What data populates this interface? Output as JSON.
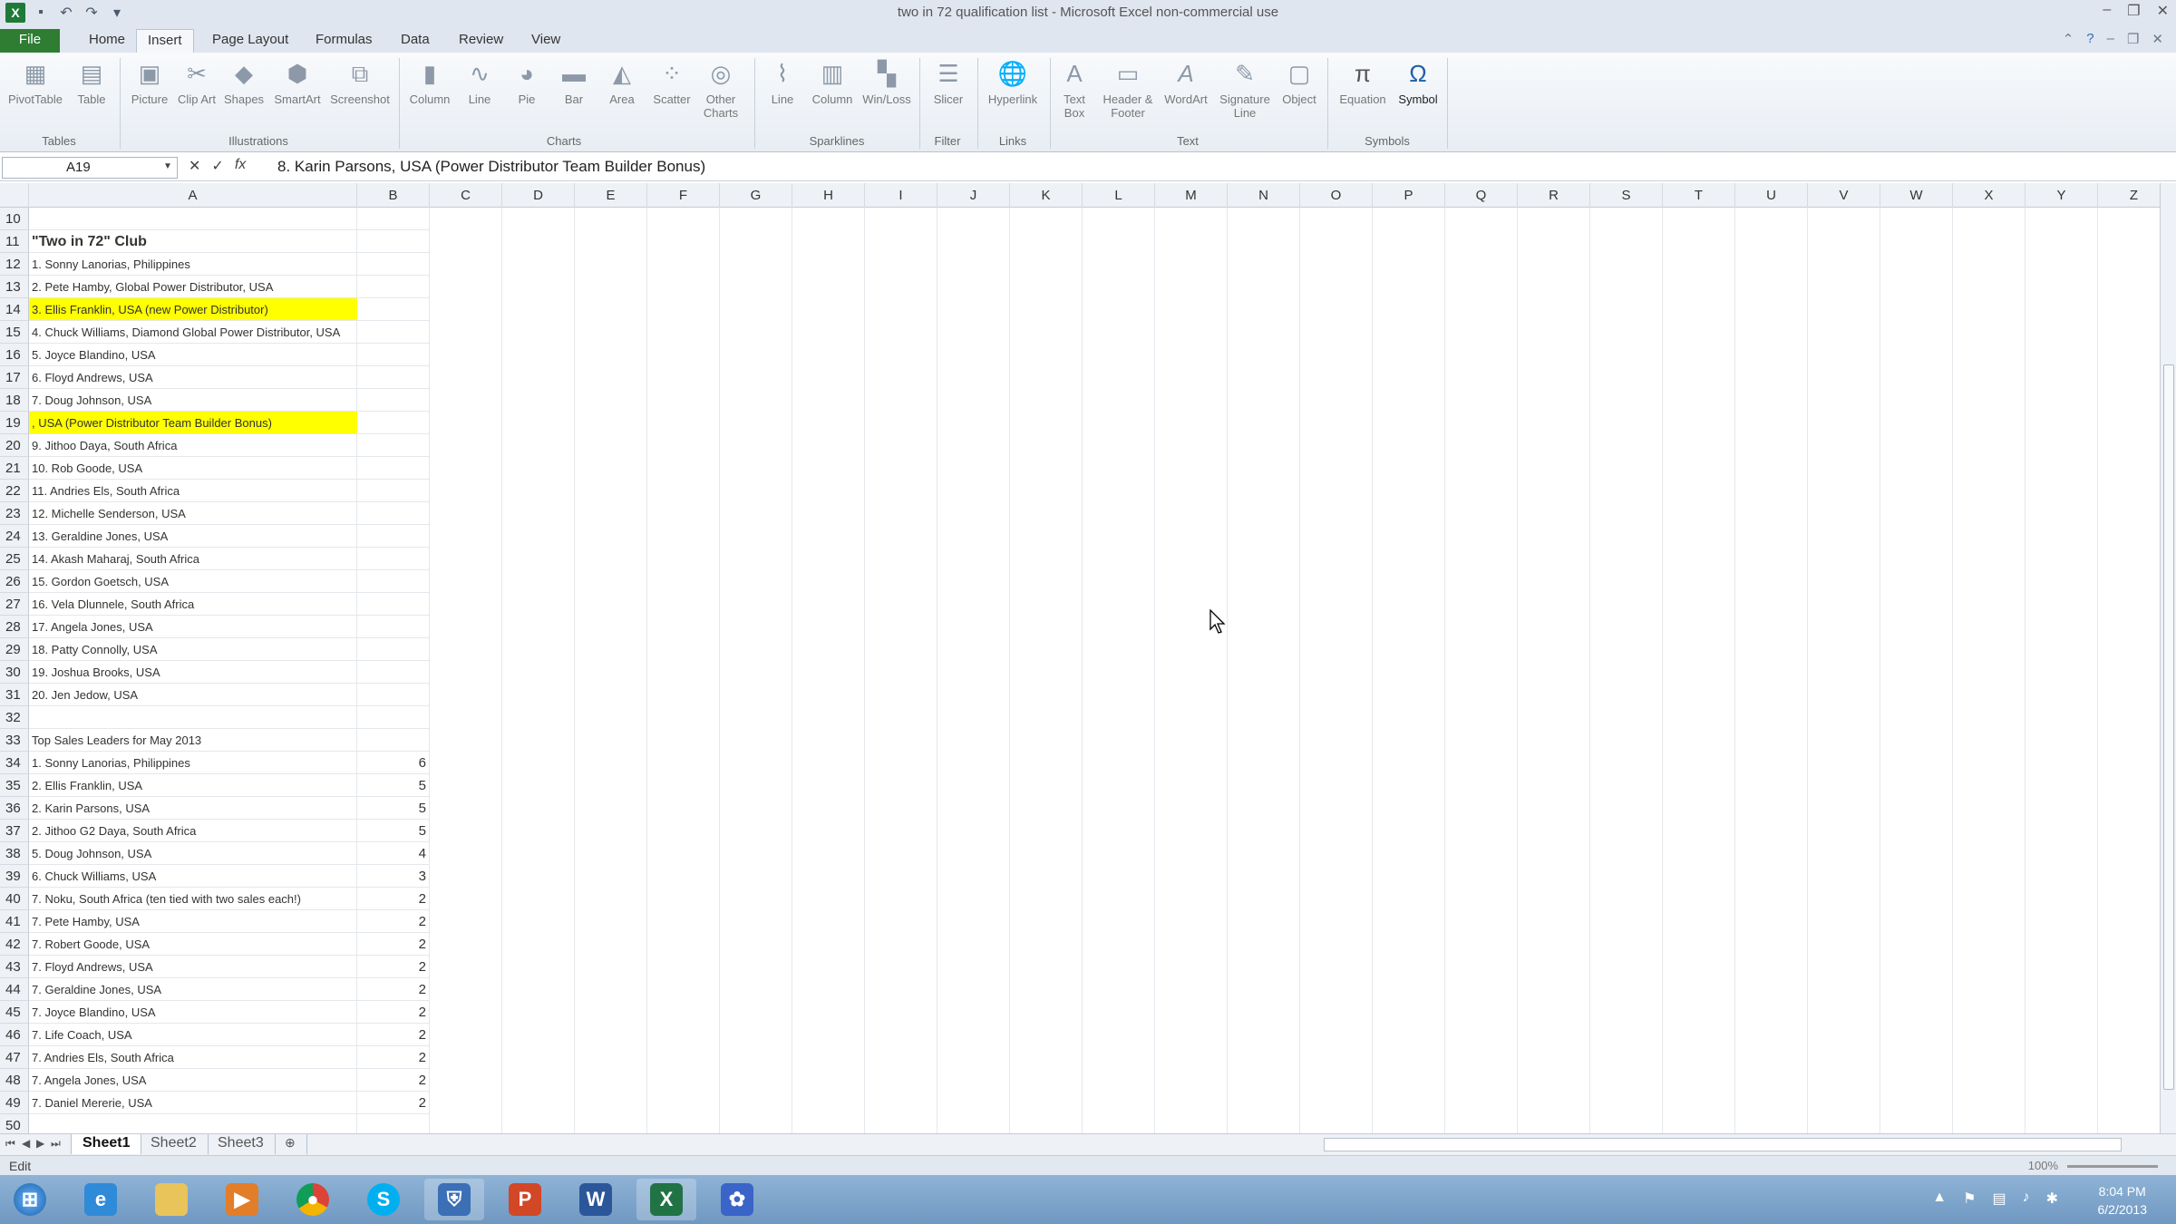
{
  "window": {
    "title": "two in 72 qualification list  -  Microsoft Excel non-commercial use",
    "controls": [
      "–",
      "❐",
      "✕"
    ]
  },
  "ribbon_tabs": [
    "File",
    "Home",
    "Insert",
    "Page Layout",
    "Formulas",
    "Data",
    "Review",
    "View"
  ],
  "ribbon": {
    "groups": [
      {
        "label": "Tables",
        "buttons": [
          "PivotTable",
          "Table"
        ]
      },
      {
        "label": "Illustrations",
        "buttons": [
          "Picture",
          "Clip Art",
          "Shapes",
          "SmartArt",
          "Screenshot"
        ]
      },
      {
        "label": "Charts",
        "buttons": [
          "Column",
          "Line",
          "Pie",
          "Bar",
          "Area",
          "Scatter",
          "Other Charts"
        ]
      },
      {
        "label": "Sparklines",
        "buttons": [
          "Line",
          "Column",
          "Win/Loss"
        ]
      },
      {
        "label": "Filter",
        "buttons": [
          "Slicer"
        ]
      },
      {
        "label": "Links",
        "buttons": [
          "Hyperlink"
        ]
      },
      {
        "label": "Text",
        "buttons": [
          "Text Box",
          "Header & Footer",
          "WordArt",
          "Signature Line",
          "Object"
        ]
      },
      {
        "label": "Symbols",
        "buttons": [
          "Equation",
          "Symbol"
        ]
      }
    ]
  },
  "formula_bar": {
    "name_box": "A19",
    "formula": "8. Karin Parsons, USA (Power Distributor Team Builder Bonus)"
  },
  "columns": [
    "A",
    "B",
    "C",
    "D",
    "E",
    "F",
    "G",
    "H",
    "I",
    "J",
    "K",
    "L",
    "M",
    "N",
    "O",
    "P",
    "Q",
    "R",
    "S",
    "T",
    "U",
    "V",
    "W",
    "X",
    "Y",
    "Z"
  ],
  "rows": [
    {
      "n": "10",
      "a": "",
      "b": ""
    },
    {
      "n": "11",
      "a": "\"Two in 72\" Club",
      "b": "",
      "bold": true
    },
    {
      "n": "12",
      "a": "1. Sonny Lanorias, Philippines",
      "b": ""
    },
    {
      "n": "13",
      "a": "2. Pete Hamby, Global Power Distributor, USA",
      "b": ""
    },
    {
      "n": "14",
      "a": "3. Ellis Franklin, USA (new Power Distributor)",
      "b": "",
      "highlight": true
    },
    {
      "n": "15",
      "a": "4. Chuck Williams, Diamond Global Power Distributor, USA",
      "b": ""
    },
    {
      "n": "16",
      "a": "5. Joyce Blandino, USA",
      "b": ""
    },
    {
      "n": "17",
      "a": "6. Floyd Andrews, USA",
      "b": ""
    },
    {
      "n": "18",
      "a": "7. Doug Johnson, USA",
      "b": ""
    },
    {
      "n": "19",
      "a": ", USA (Power Distributor Team Builder Bonus)",
      "b": "",
      "highlight": true
    },
    {
      "n": "20",
      "a": "9. Jithoo Daya, South Africa",
      "b": ""
    },
    {
      "n": "21",
      "a": "10. Rob Goode, USA",
      "b": ""
    },
    {
      "n": "22",
      "a": "11. Andries Els, South Africa",
      "b": ""
    },
    {
      "n": "23",
      "a": "12. Michelle Senderson, USA",
      "b": ""
    },
    {
      "n": "24",
      "a": "13. Geraldine Jones, USA",
      "b": ""
    },
    {
      "n": "25",
      "a": "14. Akash Maharaj, South Africa",
      "b": ""
    },
    {
      "n": "26",
      "a": "15. Gordon Goetsch, USA",
      "b": ""
    },
    {
      "n": "27",
      "a": "16. Vela Dlunnele, South Africa",
      "b": ""
    },
    {
      "n": "28",
      "a": "17. Angela Jones, USA",
      "b": ""
    },
    {
      "n": "29",
      "a": "18. Patty Connolly, USA",
      "b": ""
    },
    {
      "n": "30",
      "a": "19. Joshua Brooks, USA",
      "b": ""
    },
    {
      "n": "31",
      "a": "20. Jen Jedow, USA",
      "b": ""
    },
    {
      "n": "32",
      "a": "",
      "b": ""
    },
    {
      "n": "33",
      "a": "Top Sales Leaders for May 2013",
      "b": ""
    },
    {
      "n": "34",
      "a": "1. Sonny Lanorias, Philippines",
      "b": "6"
    },
    {
      "n": "35",
      "a": "2. Ellis Franklin, USA",
      "b": "5"
    },
    {
      "n": "36",
      "a": "2. Karin Parsons, USA",
      "b": "5"
    },
    {
      "n": "37",
      "a": "2. Jithoo G2 Daya, South Africa",
      "b": "5"
    },
    {
      "n": "38",
      "a": "5. Doug Johnson, USA",
      "b": "4"
    },
    {
      "n": "39",
      "a": "6. Chuck Williams, USA",
      "b": "3"
    },
    {
      "n": "40",
      "a": "7. Noku, South Africa (ten tied with two sales each!)",
      "b": "2"
    },
    {
      "n": "41",
      "a": "7. Pete Hamby, USA",
      "b": "2"
    },
    {
      "n": "42",
      "a": "7. Robert Goode, USA",
      "b": "2"
    },
    {
      "n": "43",
      "a": "7. Floyd Andrews, USA",
      "b": "2"
    },
    {
      "n": "44",
      "a": "7. Geraldine Jones, USA",
      "b": "2"
    },
    {
      "n": "45",
      "a": "7. Joyce Blandino, USA",
      "b": "2"
    },
    {
      "n": "46",
      "a": "7. Life Coach, USA",
      "b": "2"
    },
    {
      "n": "47",
      "a": "7. Andries Els, South Africa",
      "b": "2"
    },
    {
      "n": "48",
      "a": "7. Angela Jones, USA",
      "b": "2"
    },
    {
      "n": "49",
      "a": "7. Daniel Mererie, USA",
      "b": "2"
    },
    {
      "n": "50",
      "a": "",
      "b": ""
    }
  ],
  "sheet_tabs": [
    "Sheet1",
    "Sheet2",
    "Sheet3"
  ],
  "status": {
    "mode": "Edit",
    "zoom": "100%"
  },
  "taskbar": {
    "apps": [
      "start-orb",
      "internet-explorer",
      "file-explorer",
      "media-player",
      "chrome",
      "skype",
      "security-shield",
      "powerpoint",
      "word",
      "excel",
      "app-flower"
    ],
    "time": "8:04 PM",
    "date": "6/2/2013"
  },
  "colors": {
    "highlight": "#ffff00",
    "file_tab": "#2e7d32"
  }
}
